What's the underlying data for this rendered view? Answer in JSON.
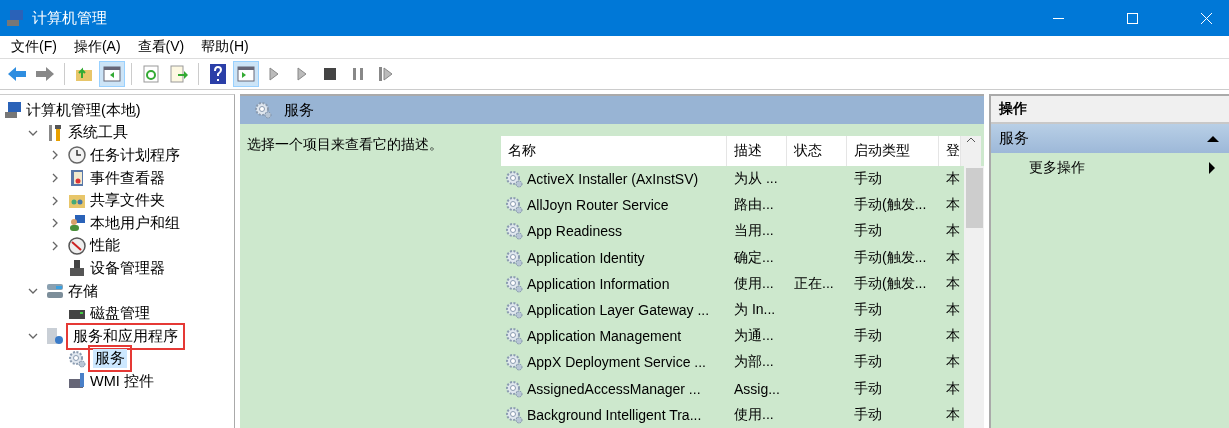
{
  "window": {
    "title": "计算机管理"
  },
  "menu": [
    "文件(F)",
    "操作(A)",
    "查看(V)",
    "帮助(H)"
  ],
  "toolbar": [
    {
      "kind": "back",
      "pressed": false
    },
    {
      "kind": "forward",
      "pressed": false
    },
    {
      "kind": "sep"
    },
    {
      "kind": "up",
      "pressed": false
    },
    {
      "kind": "tree",
      "pressed": true
    },
    {
      "kind": "sep"
    },
    {
      "kind": "refresh",
      "pressed": false
    },
    {
      "kind": "export",
      "pressed": false
    },
    {
      "kind": "sep"
    },
    {
      "kind": "help",
      "pressed": false
    },
    {
      "kind": "pane",
      "pressed": true
    },
    {
      "kind": "play",
      "pressed": false
    },
    {
      "kind": "play",
      "pressed": false
    },
    {
      "kind": "stop",
      "pressed": false
    },
    {
      "kind": "pause",
      "pressed": false
    },
    {
      "kind": "resume",
      "pressed": false
    }
  ],
  "tree": [
    {
      "label": "计算机管理(本地)",
      "selected": false,
      "highlighted": false,
      "children": [
        {
          "label": "系统工具",
          "expanded": true,
          "selected": false,
          "highlighted": false,
          "children": [
            {
              "label": "任务计划程序",
              "expanded": false,
              "selected": false,
              "highlighted": false
            },
            {
              "label": "事件查看器",
              "expanded": false,
              "selected": false,
              "highlighted": false
            },
            {
              "label": "共享文件夹",
              "expanded": false,
              "selected": false,
              "highlighted": false
            },
            {
              "label": "本地用户和组",
              "expanded": false,
              "selected": false,
              "highlighted": false
            },
            {
              "label": "性能",
              "expanded": false,
              "selected": false,
              "highlighted": false
            },
            {
              "label": "设备管理器",
              "selected": false,
              "highlighted": false
            }
          ]
        },
        {
          "label": "存储",
          "expanded": true,
          "selected": false,
          "highlighted": false,
          "children": [
            {
              "label": "磁盘管理",
              "selected": false,
              "highlighted": false
            }
          ]
        },
        {
          "label": "服务和应用程序",
          "expanded": true,
          "selected": false,
          "highlighted": true,
          "children": [
            {
              "label": "服务",
              "selected": true,
              "highlighted": true
            },
            {
              "label": "WMI 控件",
              "selected": false,
              "highlighted": false
            }
          ]
        }
      ]
    }
  ],
  "services": {
    "title": "服务",
    "description": "选择一个项目来查看它的描述。",
    "columns": [
      "名称",
      "描述",
      "状态",
      "启动类型",
      "登"
    ],
    "rows": [
      [
        "ActiveX Installer (AxInstSV)",
        "为从 ...",
        "",
        "手动",
        "本"
      ],
      [
        "AllJoyn Router Service",
        "路由...",
        "",
        "手动(触发...",
        "本"
      ],
      [
        "App Readiness",
        "当用...",
        "",
        "手动",
        "本"
      ],
      [
        "Application Identity",
        "确定...",
        "",
        "手动(触发...",
        "本"
      ],
      [
        "Application Information",
        "使用...",
        "正在...",
        "手动(触发...",
        "本"
      ],
      [
        "Application Layer Gateway ...",
        "为 In...",
        "",
        "手动",
        "本"
      ],
      [
        "Application Management",
        "为通...",
        "",
        "手动",
        "本"
      ],
      [
        "AppX Deployment Service ...",
        "为部...",
        "",
        "手动",
        "本"
      ],
      [
        "AssignedAccessManager ...",
        "Assig...",
        "",
        "手动",
        "本"
      ],
      [
        "Background Intelligent Tra...",
        "使用...",
        "",
        "手动",
        "本"
      ]
    ]
  },
  "actions": {
    "title": "操作",
    "section": {
      "label": "服务",
      "expanded": true
    },
    "items": [
      {
        "label": "更多操作"
      }
    ]
  }
}
